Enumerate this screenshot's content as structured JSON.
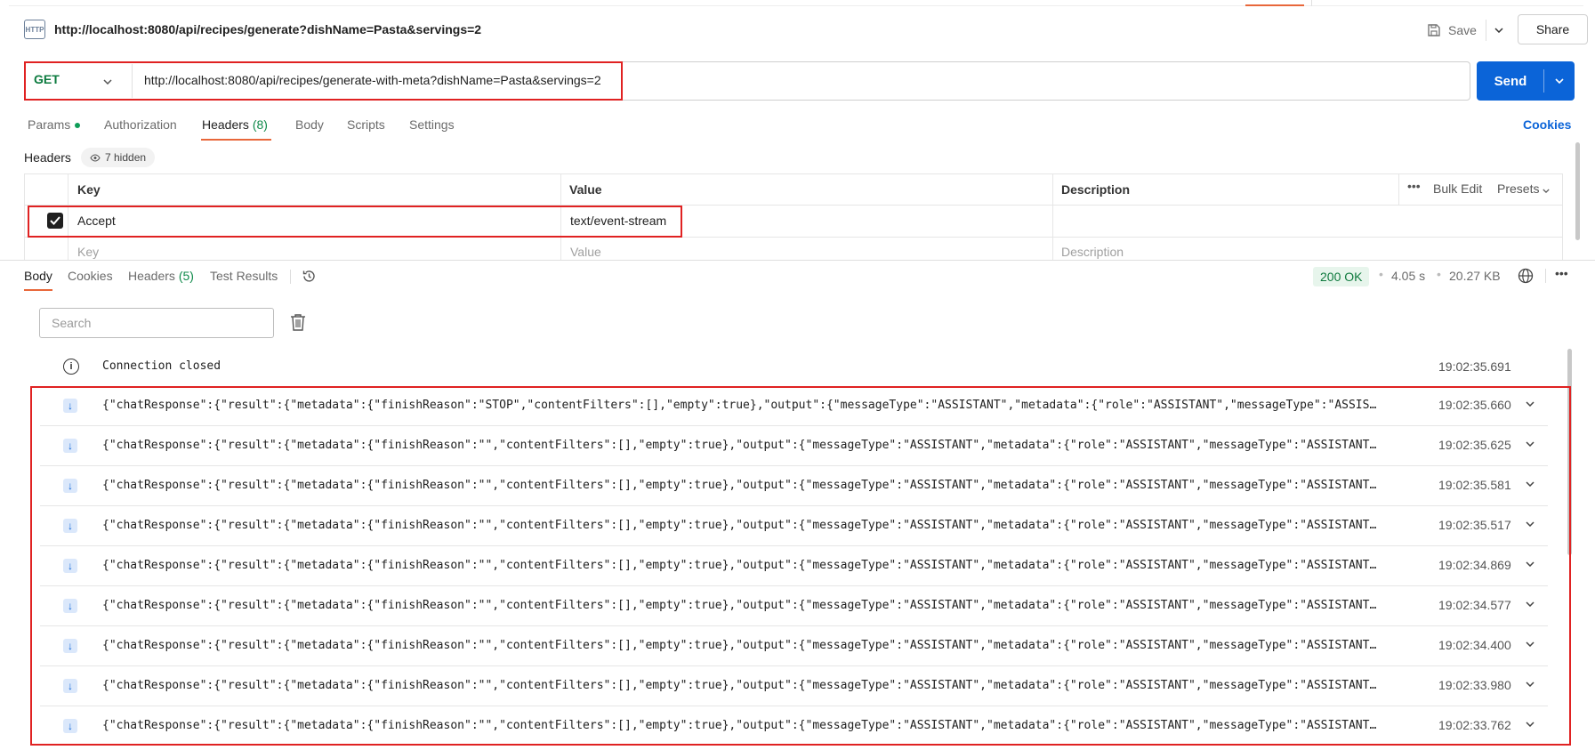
{
  "header": {
    "icon_label": "HTTP",
    "title": "http://localhost:8080/api/recipes/generate?dishName=Pasta&servings=2",
    "save_label": "Save",
    "share_label": "Share"
  },
  "request": {
    "method": "GET",
    "url": "http://localhost:8080/api/recipes/generate-with-meta?dishName=Pasta&servings=2",
    "send_label": "Send",
    "tabs": {
      "params": "Params",
      "authorization": "Authorization",
      "headers": "Headers",
      "headers_count": "(8)",
      "body": "Body",
      "scripts": "Scripts",
      "settings": "Settings"
    },
    "cookies_label": "Cookies"
  },
  "headers_section": {
    "label": "Headers",
    "hidden_badge": "7 hidden",
    "columns": {
      "key": "Key",
      "value": "Value",
      "description": "Description"
    },
    "bulk_edit": "Bulk Edit",
    "presets": "Presets",
    "rows": [
      {
        "checked": true,
        "key": "Accept",
        "value": "text/event-stream",
        "description": ""
      }
    ],
    "empty_row": {
      "key": "Key",
      "value": "Value",
      "description": "Description"
    }
  },
  "response": {
    "tabs": {
      "body": "Body",
      "cookies": "Cookies",
      "headers": "Headers",
      "headers_count": "(5)",
      "test_results": "Test Results"
    },
    "status": "200 OK",
    "time": "4.05 s",
    "size": "20.27 KB",
    "search_placeholder": "Search",
    "connection_message": "Connection closed",
    "connection_time": "19:02:35.691",
    "events": [
      {
        "text": "{\"chatResponse\":{\"result\":{\"metadata\":{\"finishReason\":\"STOP\",\"contentFilters\":[],\"empty\":true},\"output\":{\"messageType\":\"ASSISTANT\",\"metadata\":{\"role\":\"ASSISTANT\",\"messageType\":\"ASSISTANT\",...",
        "time": "19:02:35.660"
      },
      {
        "text": "{\"chatResponse\":{\"result\":{\"metadata\":{\"finishReason\":\"\",\"contentFilters\":[],\"empty\":true},\"output\":{\"messageType\":\"ASSISTANT\",\"metadata\":{\"role\":\"ASSISTANT\",\"messageType\":\"ASSISTANT\",...",
        "time": "19:02:35.625"
      },
      {
        "text": "{\"chatResponse\":{\"result\":{\"metadata\":{\"finishReason\":\"\",\"contentFilters\":[],\"empty\":true},\"output\":{\"messageType\":\"ASSISTANT\",\"metadata\":{\"role\":\"ASSISTANT\",\"messageType\":\"ASSISTANT\",...",
        "time": "19:02:35.581"
      },
      {
        "text": "{\"chatResponse\":{\"result\":{\"metadata\":{\"finishReason\":\"\",\"contentFilters\":[],\"empty\":true},\"output\":{\"messageType\":\"ASSISTANT\",\"metadata\":{\"role\":\"ASSISTANT\",\"messageType\":\"ASSISTANT\",...",
        "time": "19:02:35.517"
      },
      {
        "text": "{\"chatResponse\":{\"result\":{\"metadata\":{\"finishReason\":\"\",\"contentFilters\":[],\"empty\":true},\"output\":{\"messageType\":\"ASSISTANT\",\"metadata\":{\"role\":\"ASSISTANT\",\"messageType\":\"ASSISTANT\",...",
        "time": "19:02:34.869"
      },
      {
        "text": "{\"chatResponse\":{\"result\":{\"metadata\":{\"finishReason\":\"\",\"contentFilters\":[],\"empty\":true},\"output\":{\"messageType\":\"ASSISTANT\",\"metadata\":{\"role\":\"ASSISTANT\",\"messageType\":\"ASSISTANT\",...",
        "time": "19:02:34.577"
      },
      {
        "text": "{\"chatResponse\":{\"result\":{\"metadata\":{\"finishReason\":\"\",\"contentFilters\":[],\"empty\":true},\"output\":{\"messageType\":\"ASSISTANT\",\"metadata\":{\"role\":\"ASSISTANT\",\"messageType\":\"ASSISTANT\",...",
        "time": "19:02:34.400"
      },
      {
        "text": "{\"chatResponse\":{\"result\":{\"metadata\":{\"finishReason\":\"\",\"contentFilters\":[],\"empty\":true},\"output\":{\"messageType\":\"ASSISTANT\",\"metadata\":{\"role\":\"ASSISTANT\",\"messageType\":\"ASSISTANT\",...",
        "time": "19:02:33.980"
      },
      {
        "text": "{\"chatResponse\":{\"result\":{\"metadata\":{\"finishReason\":\"\",\"contentFilters\":[],\"empty\":true},\"output\":{\"messageType\":\"ASSISTANT\",\"metadata\":{\"role\":\"ASSISTANT\",\"messageType\":\"ASSISTANT\",...",
        "time": "19:02:33.762"
      }
    ]
  },
  "colors": {
    "accent_orange": "#e8673a",
    "send_blue": "#0b64d8",
    "method_green": "#0b7a3e",
    "highlight_red": "#e02222"
  }
}
